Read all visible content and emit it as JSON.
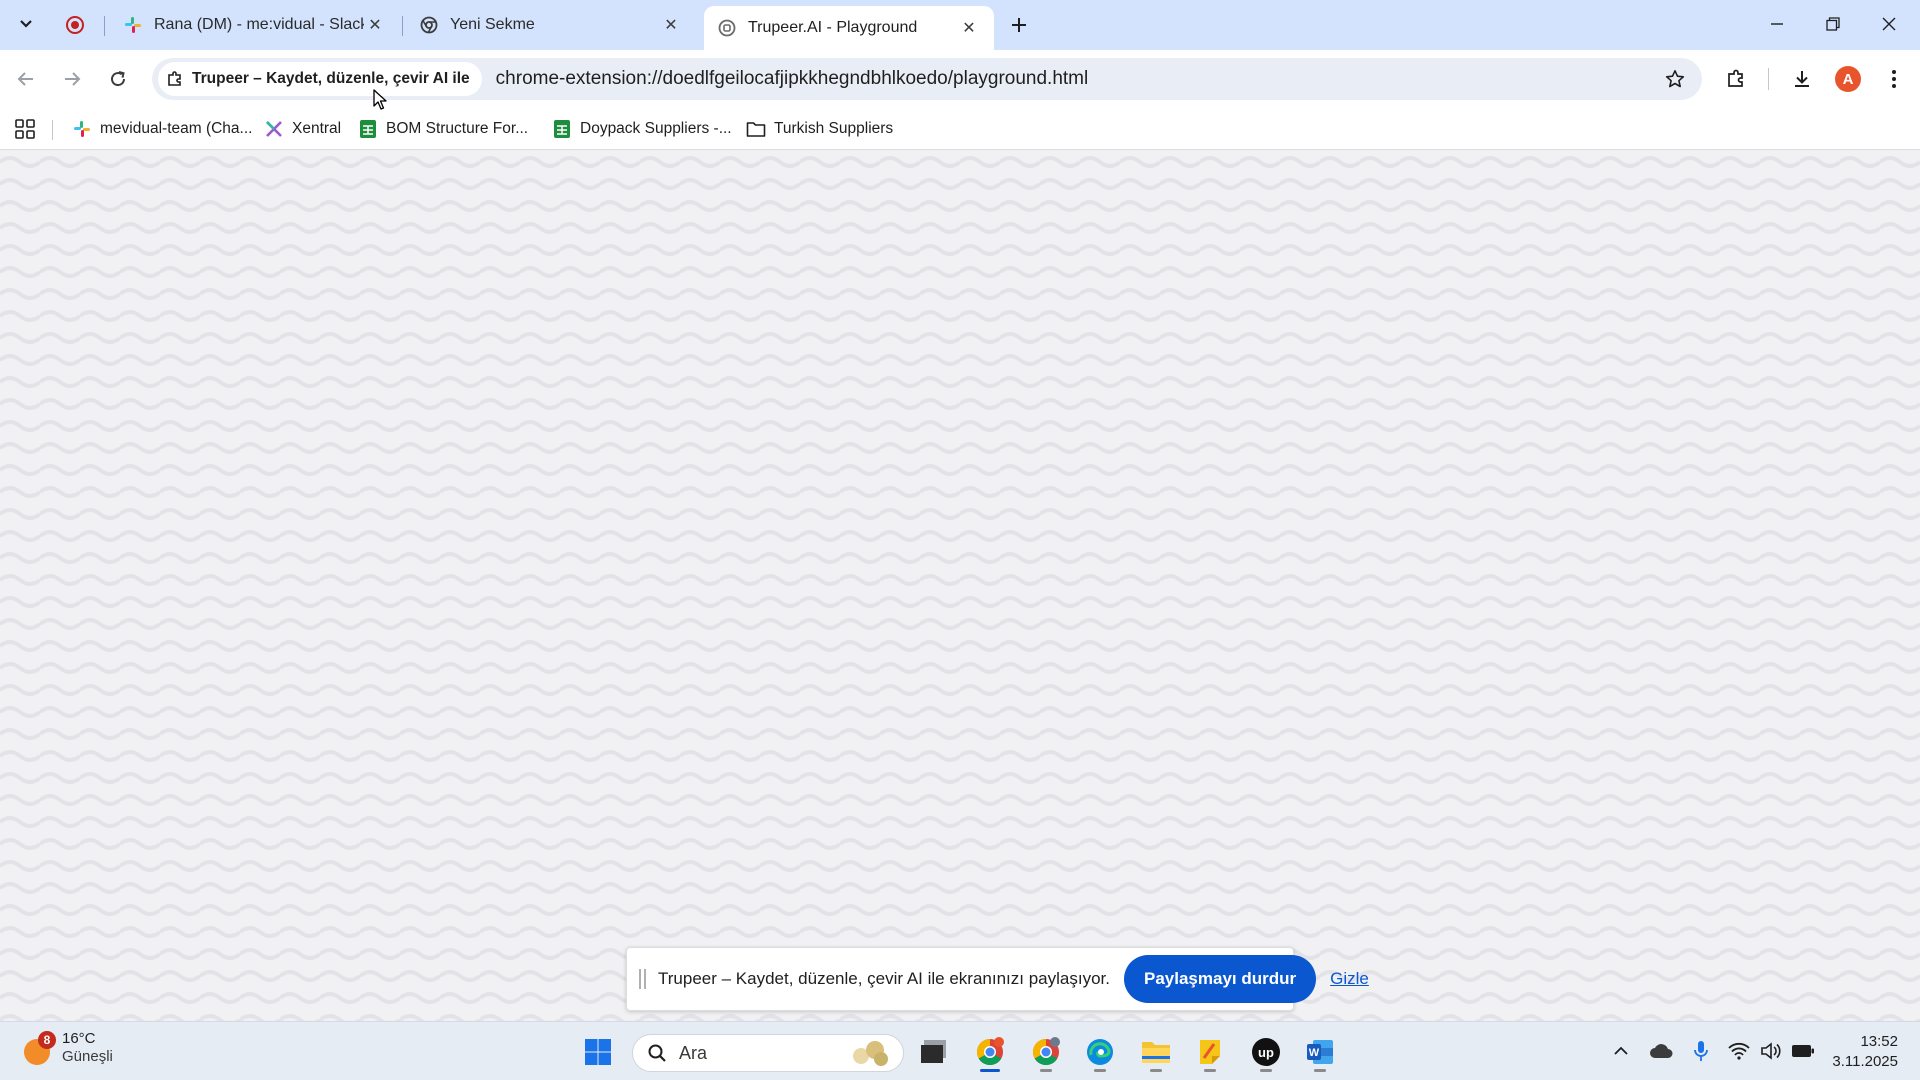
{
  "browser": {
    "tabs": [
      {
        "title": "Rana (DM) - me:vidual - Slack",
        "favicon": "slack-icon",
        "active": false
      },
      {
        "title": "Yeni Sekme",
        "favicon": "chrome-icon",
        "active": false
      },
      {
        "title": "Trupeer.AI - Playground",
        "favicon": "trupeer-icon",
        "active": true
      }
    ],
    "address": {
      "site_chip": "Trupeer – Kaydet, düzenle, çevir AI ile",
      "url": "chrome-extension://doedlfgeilocafjipkkhegndbhlkoedo/playground.html"
    },
    "profile_initial": "A",
    "bookmarks": [
      {
        "label": "mevidual-team (Cha...",
        "icon": "slack-icon"
      },
      {
        "label": "Xentral",
        "icon": "xentral-icon"
      },
      {
        "label": "BOM Structure For...",
        "icon": "sheets-icon"
      },
      {
        "label": "Doypack Suppliers -...",
        "icon": "sheets-icon"
      },
      {
        "label": "Turkish Suppliers",
        "icon": "folder-icon"
      }
    ]
  },
  "sharebar": {
    "message": "Trupeer – Kaydet, düzenle, çevir AI ile ekranınızı paylaşıyor.",
    "stop_label": "Paylaşmayı durdur",
    "hide_label": "Gizle"
  },
  "taskbar": {
    "weather": {
      "badge": "8",
      "temp": "16°C",
      "desc": "Güneşli"
    },
    "search_placeholder": "Ara",
    "clock": {
      "time": "13:52",
      "date": "3.11.2025"
    }
  },
  "colors": {
    "tabstrip_bg": "#d3e3fd",
    "accent": "#0b57d0",
    "page_bg": "#f0f0f2",
    "wave": "#e4e4e8"
  }
}
